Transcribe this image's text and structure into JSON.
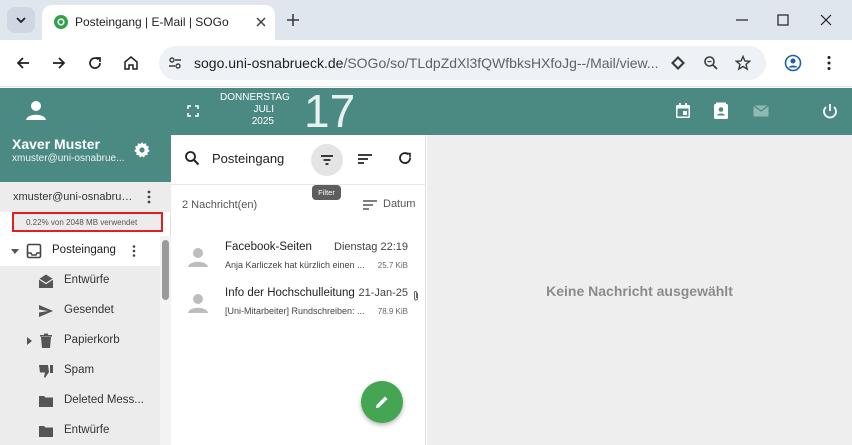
{
  "browser": {
    "tab_title": "Posteingang | E-Mail | SOGo",
    "url_host": "sogo.uni-osnabrueck.de",
    "url_path": "/SOGo/so/TLdpZdXl3fQWfbksHXfoJg--/Mail/view..."
  },
  "user": {
    "name": "Xaver Muster",
    "email": "xmuster@uni-osnabrue..."
  },
  "account": {
    "name": "xmuster@uni-osnabruec...",
    "quota": "0.22% von 2048 MB verwendet"
  },
  "folders": [
    {
      "label": "Posteingang",
      "icon": "inbox-icon"
    },
    {
      "label": "Entwürfe",
      "icon": "drafts-icon"
    },
    {
      "label": "Gesendet",
      "icon": "send-icon"
    },
    {
      "label": "Papierkorb",
      "icon": "trash-icon"
    },
    {
      "label": "Spam",
      "icon": "thumb-down-icon"
    },
    {
      "label": "Deleted Mess...",
      "icon": "folder-icon"
    },
    {
      "label": "Entwürfe",
      "icon": "folder-icon"
    }
  ],
  "header": {
    "weekday": "DONNERSTAG",
    "month": "JULI",
    "year": "2025",
    "day": "17"
  },
  "list": {
    "search_label": "Posteingang",
    "tooltip": "Filter",
    "count": "2 Nachricht(en)",
    "sort_label": "Datum",
    "messages": [
      {
        "sender": "Facebook-Seiten",
        "date": "Dienstag 22:19",
        "subject": "Anja Karliczek hat kürzlich einen ...",
        "size": "25.7 KiB"
      },
      {
        "sender": "Info der Hochschulleitung",
        "date": "21-Jan-25",
        "subject": "[Uni-Mitarbeiter] Rundschreiben: ...",
        "size": "78.9 KiB"
      }
    ]
  },
  "viewer": {
    "empty": "Keine Nachricht ausgewählt"
  },
  "colors": {
    "accent": "#4b8a82",
    "fab": "#44a653",
    "highlight": "#e02020"
  }
}
